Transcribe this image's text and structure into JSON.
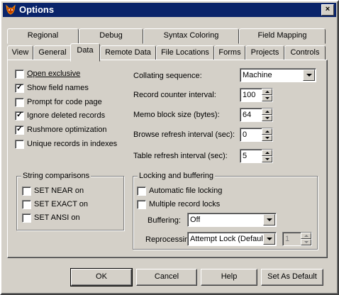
{
  "window": {
    "title": "Options",
    "close_glyph": "×"
  },
  "tabs_back": [
    "Regional",
    "Debug",
    "Syntax Coloring",
    "Field Mapping"
  ],
  "tabs_front": [
    "View",
    "General",
    "Data",
    "Remote Data",
    "File Locations",
    "Forms",
    "Projects",
    "Controls"
  ],
  "active_tab": "Data",
  "checkboxes": [
    {
      "label": "Open exclusive",
      "checked": false
    },
    {
      "label": "Show field names",
      "checked": true
    },
    {
      "label": "Prompt for code page",
      "checked": false
    },
    {
      "label": "Ignore deleted records",
      "checked": true
    },
    {
      "label": "Rushmore optimization",
      "checked": true
    },
    {
      "label": "Unique records in indexes",
      "checked": false
    }
  ],
  "fields": {
    "collating_label": "Collating sequence:",
    "collating_value": "Machine",
    "record_counter_label": "Record counter interval:",
    "record_counter_value": "100",
    "memo_label": "Memo block size (bytes):",
    "memo_value": "64",
    "browse_label": "Browse refresh interval (sec):",
    "browse_value": "0",
    "table_label": "Table refresh interval (sec):",
    "table_value": "5"
  },
  "string_comparisons": {
    "title": "String comparisons",
    "items": [
      {
        "label": "SET NEAR on",
        "checked": false
      },
      {
        "label": "SET EXACT on",
        "checked": false
      },
      {
        "label": "SET ANSI on",
        "checked": false
      }
    ]
  },
  "locking": {
    "title": "Locking and buffering",
    "items": [
      {
        "label": "Automatic file locking",
        "checked": false
      },
      {
        "label": "Multiple record locks",
        "checked": false
      }
    ],
    "buffering_label": "Buffering:",
    "buffering_value": "Off",
    "reprocessing_label": "Reprocessing:",
    "reprocessing_value": "Attempt Lock (Default)",
    "reprocessing_count": "1"
  },
  "buttons": {
    "ok": "OK",
    "cancel": "Cancel",
    "help": "Help",
    "set_default": "Set As Default"
  }
}
